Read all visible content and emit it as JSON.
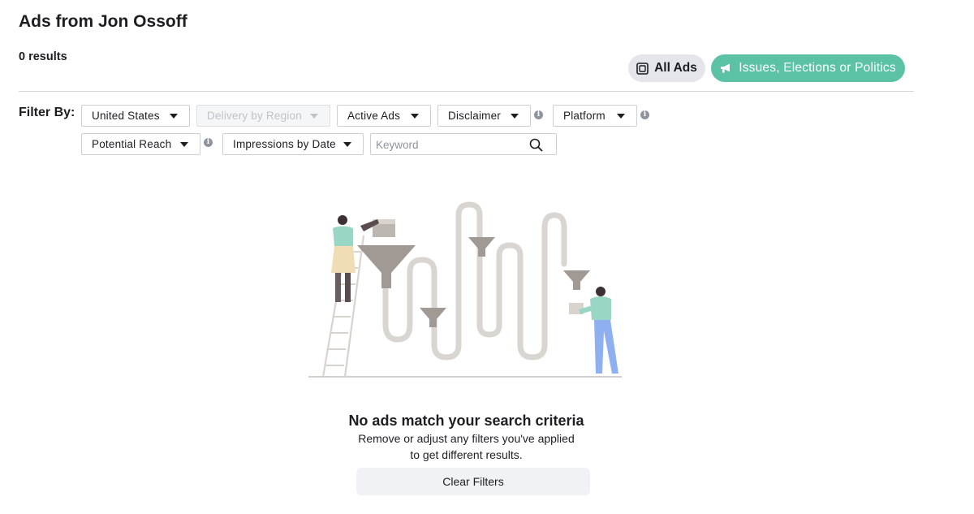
{
  "header": {
    "title": "Ads from Jon Ossoff",
    "results": "0 results"
  },
  "toggles": {
    "all_ads": "All Ads",
    "issues": "Issues, Elections or Politics",
    "active_color": "#5cc2a6"
  },
  "filters": {
    "label": "Filter By:",
    "country": "United States",
    "delivery_by_region": "Delivery by Region",
    "active_status": "Active Ads",
    "disclaimer": "Disclaimer",
    "platform": "Platform",
    "potential_reach": "Potential Reach",
    "impressions_by_date": "Impressions by Date",
    "keyword_placeholder": "Keyword",
    "keyword_value": ""
  },
  "empty_state": {
    "title": "No ads match your search criteria",
    "description": "Remove or adjust any filters you've applied to get different results.",
    "clear_button": "Clear Filters"
  },
  "icons": {
    "all_ads": "ad-box-icon",
    "issues": "megaphone-icon",
    "dropdown": "caret-down-icon",
    "info": "info-icon",
    "search": "search-icon"
  }
}
